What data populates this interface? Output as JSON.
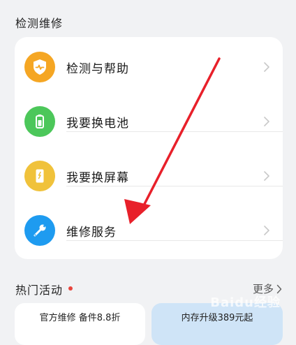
{
  "section": {
    "title": "检测维修"
  },
  "items": [
    {
      "label": "检测与帮助",
      "icon": "help-heart-icon",
      "color": "#f5a623"
    },
    {
      "label": "我要换电池",
      "icon": "battery-icon",
      "color": "#4cc75a"
    },
    {
      "label": "我要换屏幕",
      "icon": "screen-icon",
      "color": "#f0c23b"
    },
    {
      "label": "维修服务",
      "icon": "wrench-icon",
      "color": "#1e9bf0"
    }
  ],
  "hot": {
    "title": "热门活动",
    "more_label": "更多",
    "dot_color": "#e8453c"
  },
  "promos": [
    {
      "label": "官方维修 备件8.8折"
    },
    {
      "label": "内存升级389元起"
    }
  ],
  "watermark": "Baidu经验"
}
